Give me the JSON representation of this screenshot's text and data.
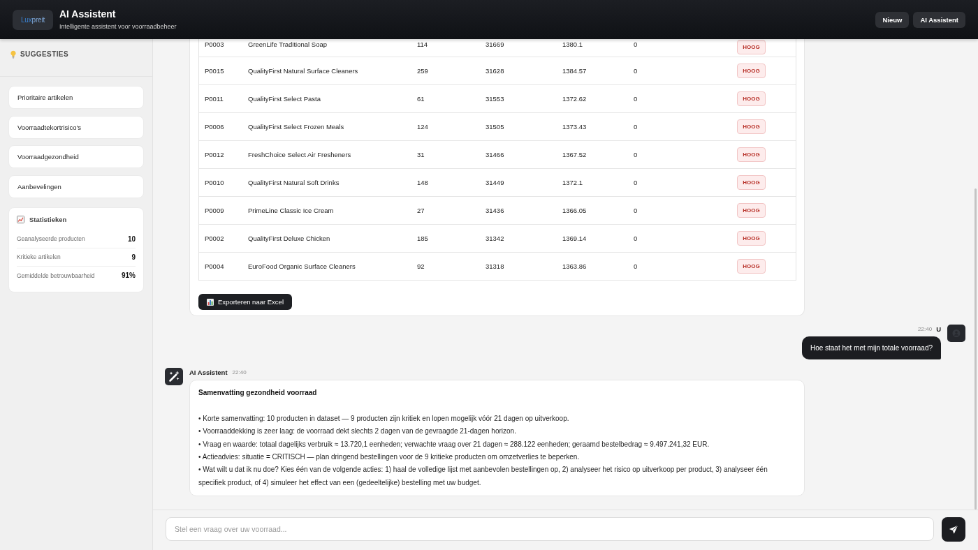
{
  "header": {
    "logo": {
      "primary": "Lux",
      "secondary": "preit"
    },
    "title": "AI Assistent",
    "subtitle": "Intelligente assistent voor voorraadbeheer",
    "buttons": [
      "Nieuw",
      "AI Assistent"
    ]
  },
  "sidebar": {
    "heading": "SUGGESTIES",
    "items": [
      "Prioritaire artikelen",
      "Voorraadtekortrisico's",
      "Voorraadgezondheid",
      "Aanbevelingen"
    ],
    "statistics": {
      "title": "Statistieken",
      "rows": [
        {
          "label": "Geanalyseerde producten",
          "value": "10"
        },
        {
          "label": "Kritieke artikelen",
          "value": "9"
        },
        {
          "label": "Gemiddelde betrouwbaarheid",
          "value": "91%"
        }
      ]
    }
  },
  "messages": [
    {
      "kind": "table",
      "rows": [
        {
          "cells": [
            "P0003",
            "GreenLife Traditional Soap",
            "114",
            "31669",
            "1380.1",
            "0"
          ],
          "priority": "HOOG"
        },
        {
          "cells": [
            "P0015",
            "QualityFirst Natural Surface Cleaners",
            "259",
            "31628",
            "1384.57",
            "0"
          ],
          "priority": "HOOG"
        },
        {
          "cells": [
            "P0011",
            "QualityFirst Select Pasta",
            "61",
            "31553",
            "1372.62",
            "0"
          ],
          "priority": "HOOG"
        },
        {
          "cells": [
            "P0006",
            "QualityFirst Select Frozen Meals",
            "124",
            "31505",
            "1373.43",
            "0"
          ],
          "priority": "HOOG"
        },
        {
          "cells": [
            "P0012",
            "FreshChoice Select Air Fresheners",
            "31",
            "31466",
            "1367.52",
            "0"
          ],
          "priority": "HOOG"
        },
        {
          "cells": [
            "P0010",
            "QualityFirst Natural Soft Drinks",
            "148",
            "31449",
            "1372.1",
            "0"
          ],
          "priority": "HOOG"
        },
        {
          "cells": [
            "P0009",
            "PrimeLine Classic Ice Cream",
            "27",
            "31436",
            "1366.05",
            "0"
          ],
          "priority": "HOOG"
        },
        {
          "cells": [
            "P0002",
            "QualityFirst Deluxe Chicken",
            "185",
            "31342",
            "1369.14",
            "0"
          ],
          "priority": "HOOG"
        },
        {
          "cells": [
            "P0004",
            "EuroFood Organic Surface Cleaners",
            "92",
            "31318",
            "1363.86",
            "0"
          ],
          "priority": "HOOG"
        }
      ],
      "export_button": "Exporteren naar Excel"
    },
    {
      "kind": "user",
      "time": "22:40",
      "sender": "U",
      "text": "Hoe staat het met mijn totale voorraad?"
    },
    {
      "kind": "reply",
      "sender": "AI Assistent",
      "time": "22:40",
      "heading": "Samenvatting gezondheid voorraad",
      "lines": [
        "• Korte samenvatting: 10 producten in dataset — 9 producten zijn kritiek en lopen mogelijk vóór 21 dagen op uitverkoop.",
        "• Voorraaddekking is zeer laag: de voorraad dekt slechts 2 dagen van de gevraagde 21-dagen horizon.",
        "• Vraag en waarde: totaal dagelijks verbruik ≈ 13.720,1 eenheden; verwachte vraag over 21 dagen ≈ 288.122 eenheden; geraamd bestelbedrag ≈ 9.497.241,32 EUR.",
        "• Actieadvies: situatie = CRITISCH — plan dringend bestellingen voor de 9 kritieke producten om omzetverlies te beperken.",
        "• Wat wilt u dat ik nu doe? Kies één van de volgende acties: 1) haal de volledige lijst met aanbevolen bestellingen op, 2) analyseer het risico op uitverkoop per product, 3) analyseer één specifiek product, of 4) simuleer het effect van een (gedeeltelijke) bestelling met uw budget."
      ]
    }
  ],
  "composer": {
    "placeholder": "Stel een vraag over uw voorraad..."
  }
}
